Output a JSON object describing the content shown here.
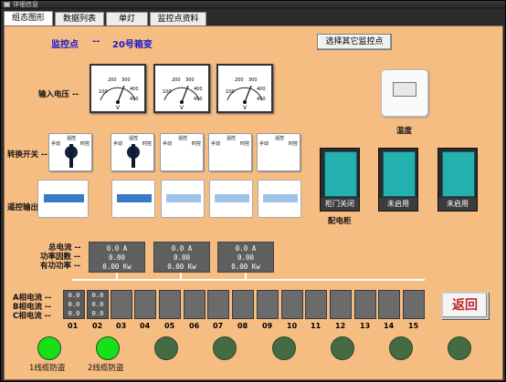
{
  "window": {
    "title": "详细信息"
  },
  "tabs": [
    {
      "label": "组态图形",
      "active": true
    },
    {
      "label": "数据列表",
      "active": false
    },
    {
      "label": "单灯",
      "active": false
    },
    {
      "label": "监控点资料",
      "active": false
    }
  ],
  "header": {
    "monitor_label": "监控点",
    "sep": "--",
    "monitor_name": "20号箱变"
  },
  "select_button": "选择其它监控点",
  "rows": {
    "voltage_label": "输入电压 --",
    "switch_label": "转换开关 --",
    "output_label": "遥控输出 --"
  },
  "gauges": [
    {
      "unit": "V",
      "ticks": [
        "100",
        "200",
        "300",
        "400",
        "450"
      ]
    },
    {
      "unit": "V",
      "ticks": [
        "100",
        "200",
        "300",
        "400",
        "450"
      ]
    },
    {
      "unit": "V",
      "ticks": [
        "100",
        "200",
        "300",
        "400",
        "450"
      ]
    }
  ],
  "switch_text": {
    "left": "手动",
    "top": "遥控",
    "right": "时控"
  },
  "temperature": {
    "label": "温度"
  },
  "cabinet": {
    "label": "配电柜",
    "doors": [
      "柜门关闭",
      "未启用",
      "未启用"
    ]
  },
  "meters_labels": [
    "总电流 --",
    "功率因数 --",
    "有功功率 --"
  ],
  "meters": [
    [
      "0.0 A",
      "0.00",
      "0.00 Kw"
    ],
    [
      "0.0 A",
      "0.00",
      "0.00 Kw"
    ],
    [
      "0.0 A",
      "0.00",
      "0.00 Kw"
    ]
  ],
  "phase_labels": [
    "A相电流 --",
    "B相电流 --",
    "C相电流 --"
  ],
  "circuits": {
    "numbers": [
      "01",
      "02",
      "03",
      "04",
      "05",
      "06",
      "07",
      "08",
      "09",
      "10",
      "11",
      "12",
      "13",
      "14",
      "15"
    ],
    "values": [
      [
        "0.0",
        "0.0",
        "0.0"
      ],
      [
        "0.0",
        "0.0",
        "0.0"
      ]
    ]
  },
  "return_button": "返回",
  "indicators": [
    {
      "label": "1线缆防盗",
      "color": "#17e017"
    },
    {
      "label": "2线缆防盗",
      "color": "#17e017"
    },
    {
      "label": "",
      "color": "#446b44"
    },
    {
      "label": "",
      "color": "#446b44"
    },
    {
      "label": "",
      "color": "#446b44"
    },
    {
      "label": "",
      "color": "#446b44"
    },
    {
      "label": "",
      "color": "#446b44"
    },
    {
      "label": "",
      "color": "#446b44"
    }
  ]
}
